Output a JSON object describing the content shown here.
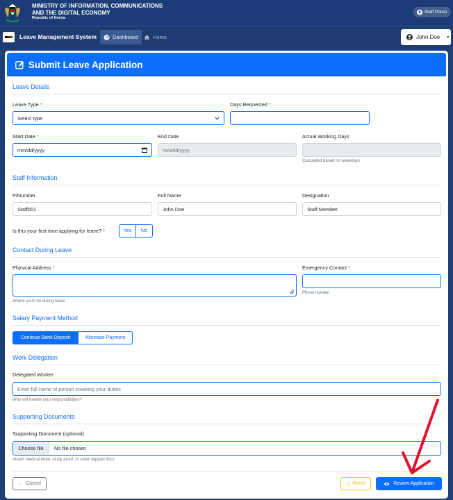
{
  "header": {
    "ministry_line1": "MINISTRY OF INFORMATION, COMMUNICATIONS",
    "ministry_line2": "AND THE DIGITAL ECONOMY",
    "republic": "Republic of Kenya",
    "staff_portal": "Staff Portal"
  },
  "nav": {
    "title": "Leave Management System",
    "dashboard": "Dashboard",
    "home": "Home",
    "user": "John Doe"
  },
  "form": {
    "title": "Submit Leave Application",
    "sections": {
      "leave_details": "Leave Details",
      "staff_information": "Staff Information",
      "contact": "Contact During Leave",
      "salary": "Salary Payment Method",
      "delegation": "Work Delegation",
      "documents": "Supporting Documents"
    },
    "leave_type": {
      "label": "Leave Type",
      "value": "Select type"
    },
    "days_requested": {
      "label": "Days Requested",
      "value": ""
    },
    "start_date": {
      "label": "Start Date",
      "value": "mm/dd/yyyy"
    },
    "end_date": {
      "label": "End Date",
      "value": "mm/dd/yyyy"
    },
    "working_days": {
      "label": "Actual Working Days",
      "help": "Calculated based on weekdays"
    },
    "pnumber": {
      "label": "P/Number",
      "value": "Staff001"
    },
    "full_name": {
      "label": "Full Name",
      "value": "John Doe"
    },
    "designation": {
      "label": "Designation",
      "value": "Staff Member"
    },
    "first_time": {
      "label": "Is this your first time applying for leave?",
      "yes": "Yes",
      "no": "No"
    },
    "address": {
      "label": "Physical Address",
      "help": "Where you'll be during leave"
    },
    "emergency": {
      "label": "Emergency Contact",
      "help": "Phone number"
    },
    "salary": {
      "option1": "Continue Bank Deposit",
      "option2": "Alternate Payment"
    },
    "delegated": {
      "label": "Delegated Worker",
      "placeholder": "Enter full name of person covering your duties",
      "help": "Who will handle your responsibilities?"
    },
    "document": {
      "label": "Supporting Document (optional)",
      "button": "Choose file",
      "status": "No file chosen",
      "help": "Attach medical letter, study proof, or other support docs"
    },
    "required_mark": "*",
    "cancel": "Cancel",
    "reset": "Reset",
    "review": "Review Application"
  },
  "colors": {
    "primary": "#0d6efd",
    "navy": "#1b3c76",
    "annotation_arrow": "#e0112b",
    "reset": "#ffc107"
  },
  "icons": [
    "crest-icon",
    "user-circle-icon",
    "dashboard-icon",
    "home-icon",
    "edit-icon",
    "chevron-down-icon",
    "calendar-icon",
    "arrow-left-icon",
    "reset-icon",
    "eye-icon",
    "red-arrow-annotation"
  ]
}
